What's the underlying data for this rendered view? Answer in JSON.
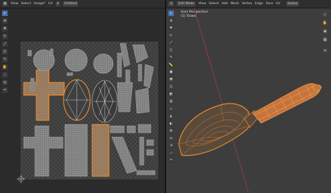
{
  "uv_editor": {
    "header": {
      "view": "View",
      "select": "Select",
      "image_menu": "Image*",
      "uv": "UV",
      "image_name": "Untitled"
    },
    "tools": [
      "select-icon",
      "cursor-icon",
      "move-icon",
      "rotate-icon",
      "scale-icon",
      "transform-icon",
      "annotate-icon",
      "grab-icon",
      "relax-icon",
      "pinch-icon",
      "rip-icon"
    ]
  },
  "viewport": {
    "header": {
      "mode": "Edit Mode",
      "view": "View",
      "select": "Select",
      "add": "Add",
      "mesh": "Mesh",
      "vertex": "Vertex",
      "edge": "Edge",
      "face": "Face",
      "uv": "UV",
      "orientation": "Global"
    },
    "overlay": {
      "perspective": "User Perspective",
      "object": "(1) Trowel"
    },
    "tools": [
      "select-icon",
      "cursor-icon",
      "move-icon",
      "rotate-icon",
      "scale-icon",
      "transform-icon",
      "annotate-icon",
      "measure-icon",
      "add-cube-icon",
      "extrude-icon",
      "inset-icon",
      "bevel-icon",
      "loopcut-icon",
      "knife-icon",
      "polybuild-icon",
      "spin-icon",
      "smooth-icon",
      "edge-slide-icon",
      "shrink-icon",
      "shear-icon",
      "rip-icon"
    ]
  },
  "colors": {
    "selected": "#e8892c",
    "wire": "#9a9a9a",
    "accent": "#4772b3",
    "x_axis": "#a43b45"
  }
}
